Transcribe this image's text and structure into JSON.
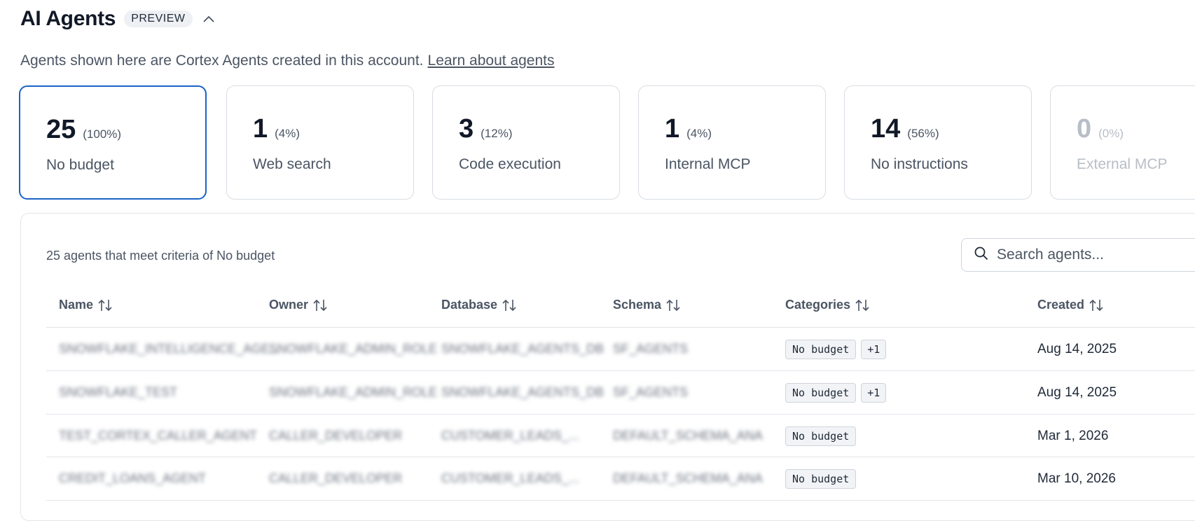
{
  "header": {
    "title": "AI Agents",
    "badge": "PREVIEW",
    "description": "Agents shown here are Cortex Agents created in this account.",
    "learn_link": "Learn about agents"
  },
  "cards": [
    {
      "count": "25",
      "percent": "(100%)",
      "label": "No budget",
      "selected": true
    },
    {
      "count": "1",
      "percent": "(4%)",
      "label": "Web search"
    },
    {
      "count": "3",
      "percent": "(12%)",
      "label": "Code execution"
    },
    {
      "count": "1",
      "percent": "(4%)",
      "label": "Internal MCP"
    },
    {
      "count": "14",
      "percent": "(56%)",
      "label": "No instructions"
    },
    {
      "count": "0",
      "percent": "(0%)",
      "label": "External MCP",
      "disabled": true
    }
  ],
  "table": {
    "summary": "25 agents that meet criteria of No budget",
    "search_placeholder": "Search agents...",
    "columns": {
      "name": "Name",
      "owner": "Owner",
      "database": "Database",
      "schema": "Schema",
      "categories": "Categories",
      "created": "Created"
    },
    "rows": [
      {
        "name": "SNOWFLAKE_INTELLIGENCE_AGE...",
        "owner": "SNOWFLAKE_ADMIN_ROLE",
        "database": "SNOWFLAKE_AGENTS_DB",
        "schema": "SF_AGENTS",
        "categories": [
          "No budget",
          "+1"
        ],
        "created": "Aug 14, 2025"
      },
      {
        "name": "SNOWFLAKE_TEST",
        "owner": "SNOWFLAKE_ADMIN_ROLE",
        "database": "SNOWFLAKE_AGENTS_DB",
        "schema": "SF_AGENTS",
        "categories": [
          "No budget",
          "+1"
        ],
        "created": "Aug 14, 2025"
      },
      {
        "name": "TEST_CORTEX_CALLER_AGENT",
        "owner": "CALLER_DEVELOPER",
        "database": "CUSTOMER_LEADS_...",
        "schema": "DEFAULT_SCHEMA_ANA",
        "categories": [
          "No budget"
        ],
        "created": "Mar 1, 2026"
      },
      {
        "name": "CREDIT_LOANS_AGENT",
        "owner": "CALLER_DEVELOPER",
        "database": "CUSTOMER_LEADS_...",
        "schema": "DEFAULT_SCHEMA_ANA",
        "categories": [
          "No budget"
        ],
        "created": "Mar 10, 2026"
      }
    ]
  }
}
